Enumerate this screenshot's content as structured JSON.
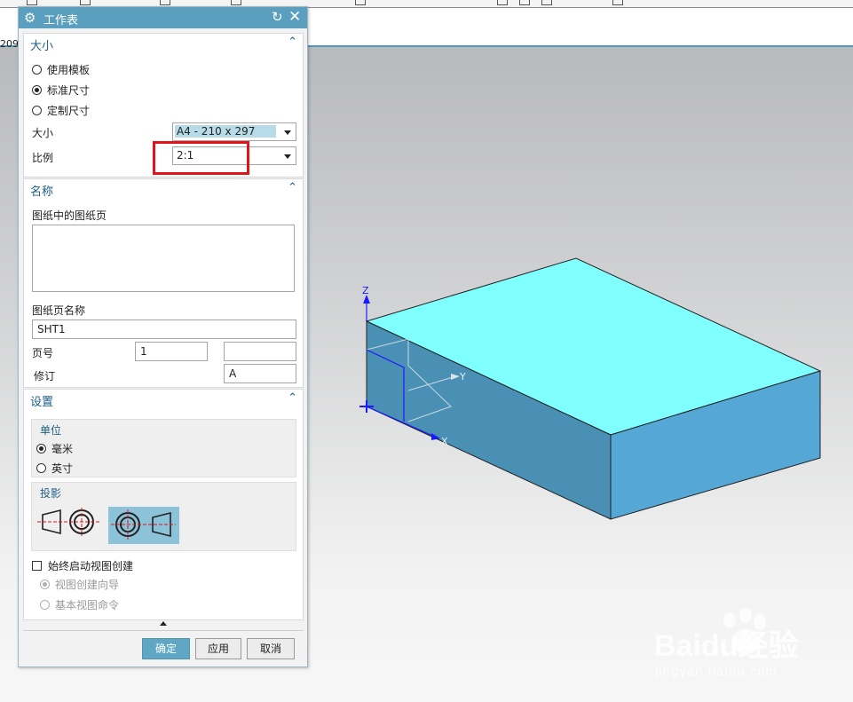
{
  "coord_readout": "209",
  "dialog": {
    "title": "工作表",
    "icons": {
      "title": "gear-icon",
      "reset": "reset-icon",
      "close": "close-icon"
    }
  },
  "size_section": {
    "header": "大小",
    "options": [
      "使用模板",
      "标准尺寸",
      "定制尺寸"
    ],
    "selected": "标准尺寸",
    "size_label": "大小",
    "size_value": "A4 - 210 x 297",
    "scale_label": "比例",
    "scale_value": "2:1"
  },
  "name_section": {
    "header": "名称",
    "sheets_label": "图纸中的图纸页",
    "sheet_name_label": "图纸页名称",
    "sheet_name_value": "SHT1",
    "page_number_label": "页号",
    "page_number_value": "1",
    "page_number_extra": "",
    "revision_label": "修订",
    "revision_value": "A"
  },
  "settings_section": {
    "header": "设置",
    "units_label": "单位",
    "units_options": [
      "毫米",
      "英寸"
    ],
    "units_selected": "毫米",
    "projection_label": "投影",
    "always_start_label": "始终启动视图创建",
    "always_start_checked": false,
    "view_options": [
      "视图创建向导",
      "基本视图命令"
    ],
    "view_selected": "视图创建向导"
  },
  "buttons": {
    "ok": "确定",
    "apply": "应用",
    "cancel": "取消"
  },
  "axes": {
    "z": "Z",
    "y": "Y",
    "x": "X"
  },
  "colors": {
    "title_bar": "#5a9fbd",
    "model_top": "#80ffff",
    "model_front": "#4a90b5",
    "model_side": "#55a8d6",
    "highlight": "#e0141a"
  },
  "watermark": {
    "brand": "Baidu经验",
    "url": "jingyan.baidu.com"
  }
}
